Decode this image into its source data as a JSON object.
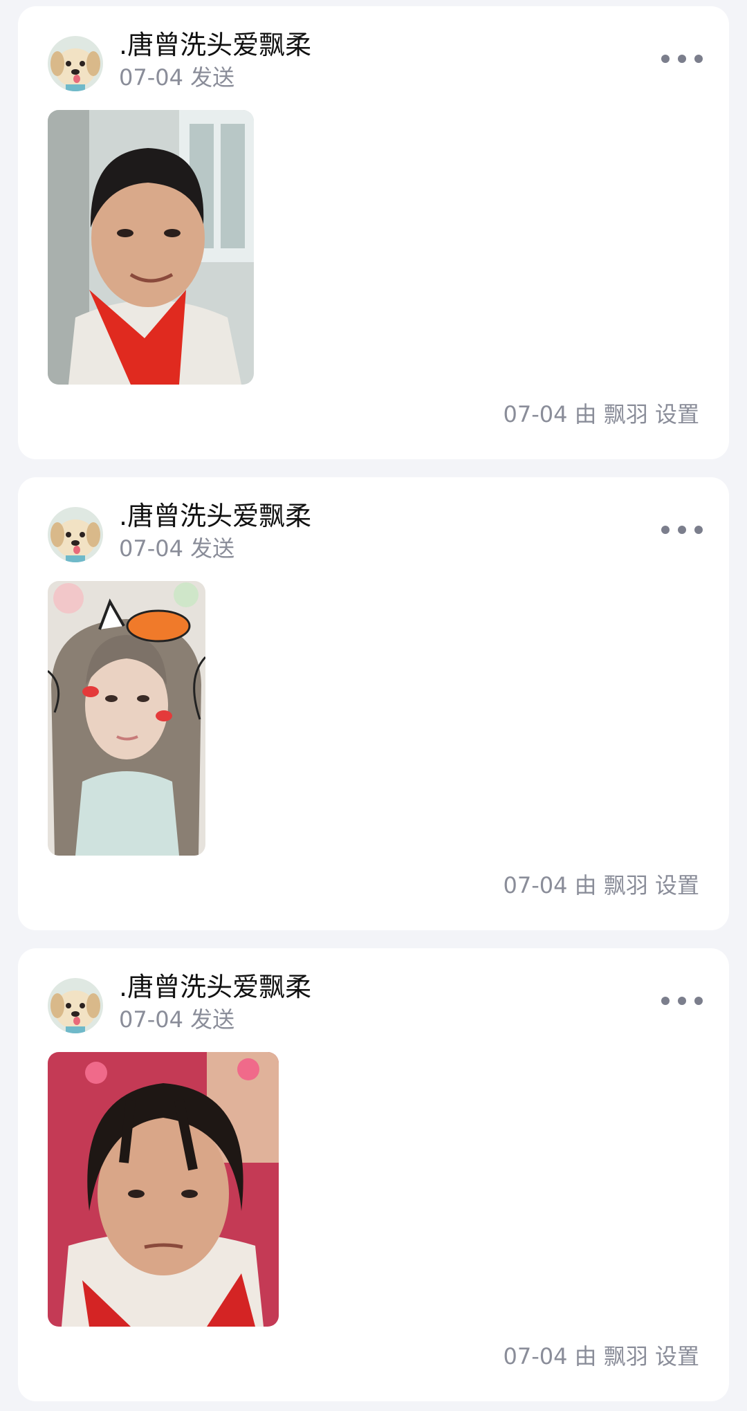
{
  "posts": [
    {
      "user_name": ".唐曾洗头爱飘柔",
      "sent_label": "07-04 发送",
      "footer_label": "07-04 由 飘羽 设置",
      "photo_icon": "boy-portrait-photo"
    },
    {
      "user_name": ".唐曾洗头爱飘柔",
      "sent_label": "07-04 发送",
      "footer_label": "07-04 由 飘羽 设置",
      "photo_icon": "girl-with-cat-sticker-photo"
    },
    {
      "user_name": ".唐曾洗头爱飘柔",
      "sent_label": "07-04 发送",
      "footer_label": "07-04 由 飘羽 设置",
      "photo_icon": "girl-portrait-photo"
    }
  ],
  "icons": {
    "avatar": "puppy-avatar-icon",
    "more": "more-dots-icon"
  },
  "colors": {
    "background": "#f3f4f8",
    "card": "#ffffff",
    "name_text": "#111111",
    "meta_text": "#8a8d99"
  }
}
